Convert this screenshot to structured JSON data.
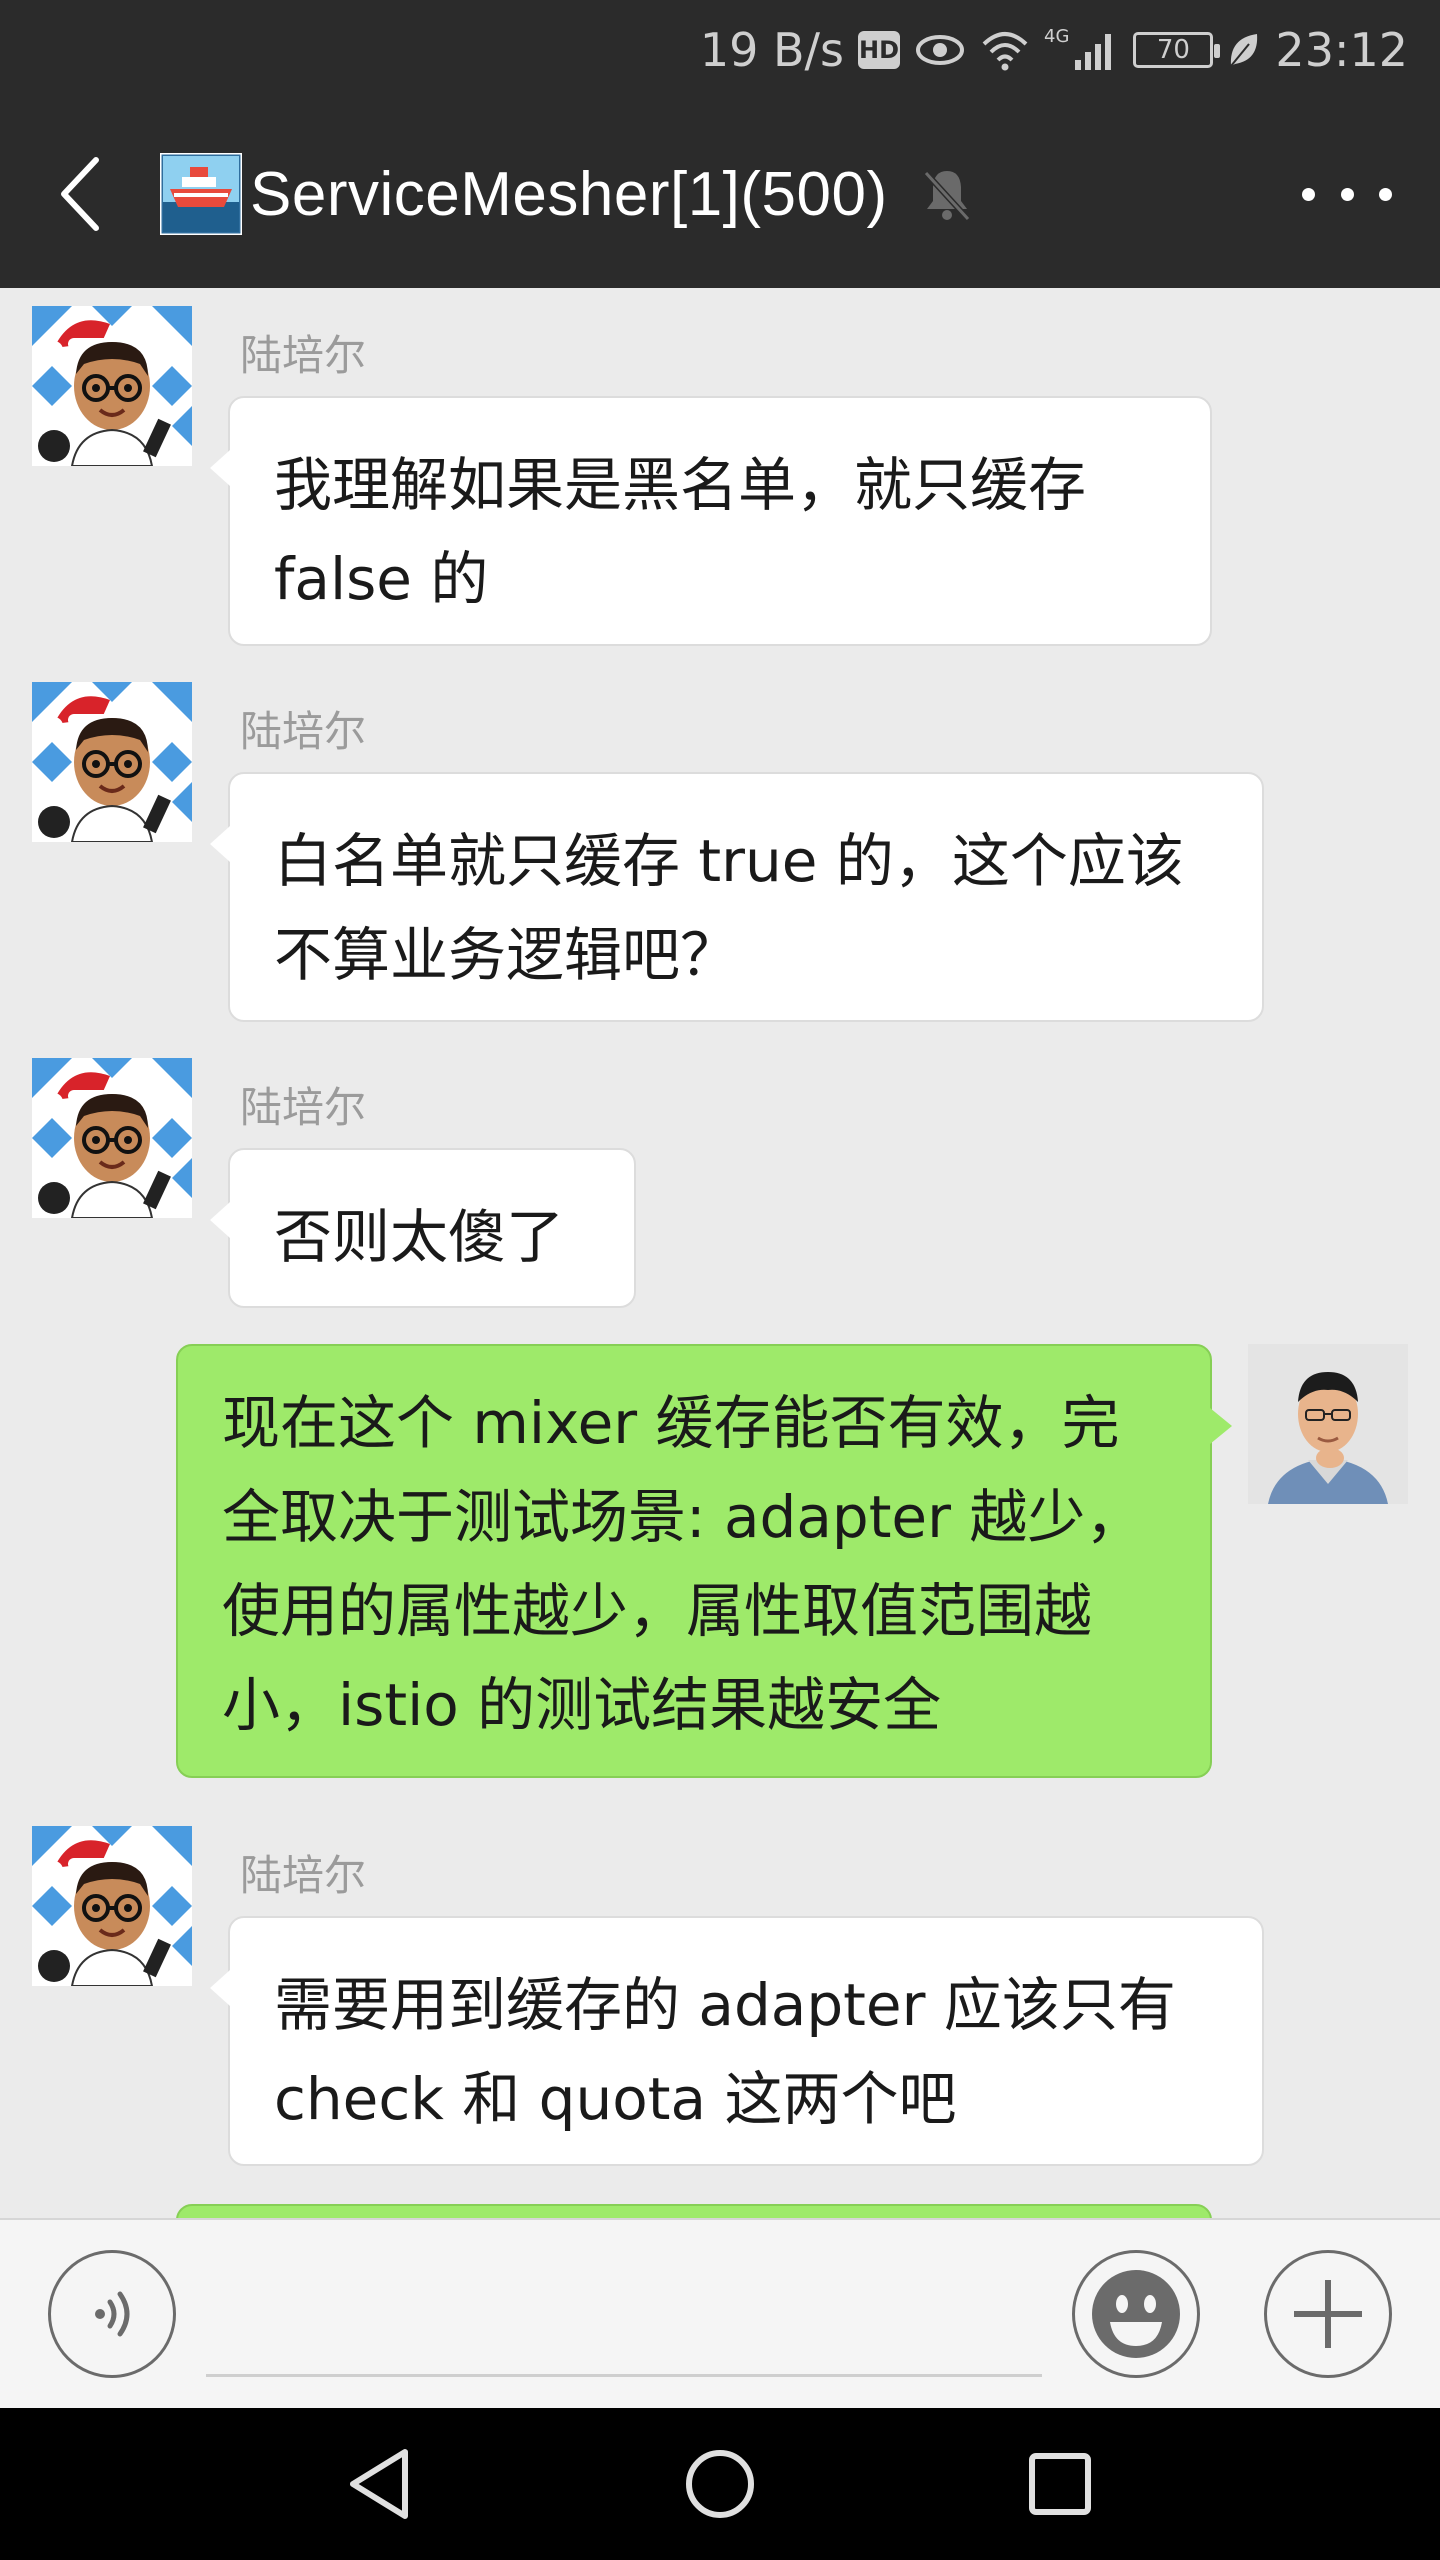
{
  "status_bar": {
    "speed": "19 B/s",
    "hd": "HD",
    "network": "4G",
    "battery": "70",
    "time": "23:12"
  },
  "header": {
    "title": "ServiceMesher[1](500)",
    "back_icon": "chevron-left-icon",
    "mute_icon": "bell-muted-icon",
    "more_icon": "more-dots-icon"
  },
  "messages": [
    {
      "direction": "in",
      "sender": "陆培尔",
      "text": "我理解如果是黑名单，就只缓存\nfalse 的"
    },
    {
      "direction": "in",
      "sender": "陆培尔",
      "text": "白名单就只缓存 true 的，这个应该\n不算业务逻辑吧？"
    },
    {
      "direction": "in",
      "sender": "陆培尔",
      "text": "否则太傻了"
    },
    {
      "direction": "out",
      "sender": "",
      "text": "现在这个 mixer 缓存能否有效，完\n全取决于测试场景: adapter 越少，\n使用的属性越少，属性取值范围越\n小，istio 的测试结果越安全"
    },
    {
      "direction": "in",
      "sender": "陆培尔",
      "text": "需要用到缓存的 adapter 应该只有\ncheck 和 quota 这两个吧"
    }
  ],
  "input_bar": {
    "voice_icon": "voice-icon",
    "emoji_icon": "emoji-icon",
    "plus_icon": "plus-icon"
  },
  "nav_bar": {
    "back_icon": "nav-back-icon",
    "home_icon": "nav-home-icon",
    "recents_icon": "nav-recents-icon"
  },
  "colors": {
    "header_bg": "#2b2b2b",
    "chat_bg": "#ebebeb",
    "incoming_bubble": "#ffffff",
    "outgoing_bubble": "#9eea6a"
  }
}
